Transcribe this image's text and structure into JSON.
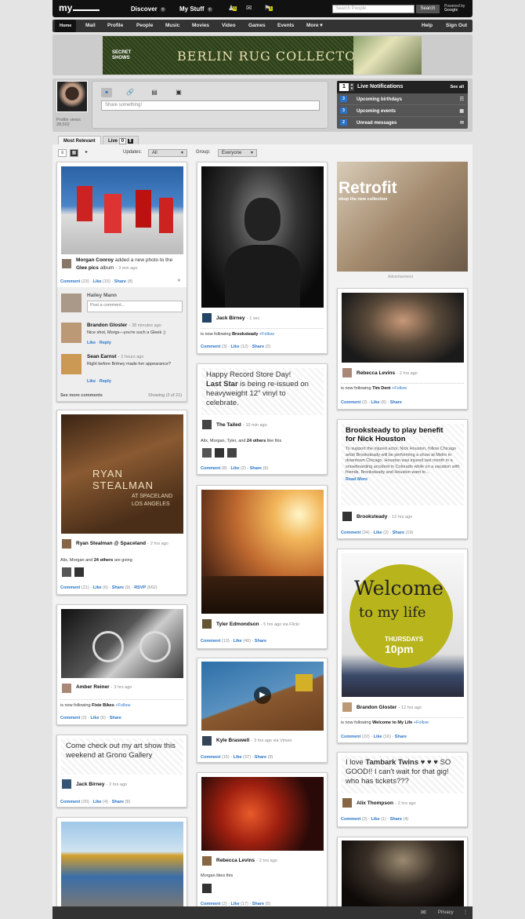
{
  "app": {
    "logo": "my"
  },
  "topnav": {
    "discover": "Discover",
    "mystuff": "My Stuff",
    "badge1": "6",
    "badge2": "1",
    "search_placeholder": "Search People",
    "search_button": "Search",
    "powered": "Powered by",
    "google": "Google"
  },
  "nav": [
    "Home",
    "Mail",
    "Profile",
    "People",
    "Music",
    "Movies",
    "Video",
    "Games",
    "Events",
    "More"
  ],
  "nav_right": [
    "Help",
    "Sign Out"
  ],
  "banner": {
    "brand": "SECRET SHOWS",
    "title": "BERLIN RUG COLLECTORS"
  },
  "profile": {
    "views_label": "Profile views",
    "views": "28,502",
    "share_placeholder": "Share something!"
  },
  "notifications": {
    "count": "1",
    "title": "Live Notifications",
    "see_all": "See all",
    "rows": [
      {
        "n": "3",
        "label": "Upcoming birthdays"
      },
      {
        "n": "3",
        "label": "Upcoming events"
      },
      {
        "n": "2",
        "label": "Unread messages"
      }
    ]
  },
  "tabs": {
    "relevant": "Most Relevant",
    "live": "Live",
    "live_count": "0"
  },
  "filters": {
    "updates_label": "Updates:",
    "updates_value": "All",
    "group_label": "Group:",
    "group_value": "Everyone"
  },
  "col1": {
    "c1": {
      "author": "Morgan Conroy",
      "text": "added a new photo to the",
      "album": "Glee pics",
      "album_sfx": "album",
      "time": "3 min ago",
      "comment": "Comment",
      "comment_n": "(23)",
      "like": "Like",
      "like_n": "(15)",
      "share": "Share",
      "share_n": "(8)",
      "commenter": "Hailey Mann",
      "add_comment": "Post a comment...",
      "c1name": "Brandon Gloster",
      "c1time": "38 minutes ago",
      "c1text": "Nice shot, Morgs—you're such a Gleek ;)",
      "c2name": "Sean Earnst",
      "c2time": "2 hours ago",
      "c2text": "Right before Britney made her appearance?",
      "reply": "Reply",
      "see_more": "See more comments",
      "showing": "Showing (2 of 21)"
    },
    "c2": {
      "img": "RYAN STEALMAN",
      "img_sub": "AT SPACELAND LOS ANGELES",
      "author": "Ryan Stealman @ Spaceland",
      "time": "2 hrs ago",
      "going_a": "Alix, Morgan",
      "going_and": "and",
      "going_b": "24 others",
      "going_c": "are going",
      "comment": "Comment",
      "comment_n": "(21)",
      "like": "Like",
      "like_n": "(6)",
      "share": "Share",
      "share_n": "(9)",
      "rsvp": "RSVP",
      "rsvp_n": "(662)"
    },
    "c3": {
      "author": "Amber Reiner",
      "time": "3 hrs ago",
      "following": "is now following",
      "target": "Fixie Bikes",
      "follow": "+Follow",
      "comment": "Comment",
      "comment_n": "(2)",
      "like": "Like",
      "like_n": "(6)",
      "share": "Share"
    },
    "c4": {
      "quote": "Come check out my art show this weekend at Grono Gallery",
      "author": "Jack Birney",
      "time": "2 hrs ago",
      "comment": "Comment",
      "comment_n": "(20)",
      "like": "Like",
      "like_n": "(4)",
      "share": "Share",
      "share_n": "(8)"
    }
  },
  "col2": {
    "c1": {
      "author": "Jack Birney",
      "time": "1 sec",
      "following": "is now following",
      "target": "Brooksteady",
      "follow": "+Follow",
      "comment": "Comment",
      "comment_n": "(3)",
      "like": "Like",
      "like_n": "(12)",
      "share": "Share",
      "share_n": "(2)"
    },
    "c2": {
      "q1": "Happy Record Store Day!",
      "q2": "Last Star",
      "q3": "is being re-issued on heavyweight 12\" vinyl to celebrate.",
      "author": "The Tailed",
      "time": "10 min ago",
      "likes_a": "Alix, Morgan, Tyler,",
      "likes_and": "and",
      "likes_b": "24 others",
      "likes_c": "like this",
      "comment": "Comment",
      "comment_n": "(8)",
      "like": "Like",
      "like_n": "(2)",
      "share": "Share",
      "share_n": "(6)"
    },
    "c3": {
      "author": "Tyler Edmondson",
      "time": "5 hrs ago via Flickr",
      "comment": "Comment",
      "comment_n": "(13)",
      "like": "Like",
      "like_n": "(40)",
      "share": "Share"
    },
    "c4": {
      "author": "Kyle Braswell",
      "time": "3 hrs ago via Vimeo",
      "comment": "Comment",
      "comment_n": "(15)",
      "like": "Like",
      "like_n": "(37)",
      "share": "Share",
      "share_n": "(9)"
    },
    "c5": {
      "author": "Rebecca Levins",
      "time": "2 hrs ago",
      "likes": "Morgan",
      "likes_c": "likes this",
      "comment": "Comment",
      "comment_n": "(2)",
      "like": "Like",
      "like_n": "(17)",
      "share": "Share",
      "share_n": "(5)"
    }
  },
  "col3": {
    "ad": {
      "title": "Retrofit",
      "sub": "shop the new collection",
      "label": "Advertisement"
    },
    "c1": {
      "author": "Rebecca Levins",
      "time": "2 hrs ago",
      "following": "is now following",
      "target": "Tim Dent",
      "follow": "+Follow",
      "comment": "Comment",
      "comment_n": "(2)",
      "like": "Like",
      "like_n": "(8)",
      "share": "Share"
    },
    "c2": {
      "title": "Brooksteady to play benefit for Nick Houston",
      "body": "To support the injured actor, Nick Houston, follow Chicago artist Brooksteady will be performing a show at Metro in downtown Chicago. Houston was injured last month in a snowboarding accident in Colorado while on a vacation with friends. Brooksteady and Houston want to...",
      "read_more": "Read More",
      "author": "Brooksteady",
      "time": "12 hrs ago",
      "comment": "Comment",
      "comment_n": "(34)",
      "like": "Like",
      "like_n": "(2)",
      "share": "Share",
      "share_n": "(19)"
    },
    "c3": {
      "w1": "Welcome",
      "w2": "to my life",
      "w3": "THURSDAYS",
      "w4": "10pm",
      "author": "Brandon Gloster",
      "time": "12 hrs ago",
      "following": "is now following",
      "target": "Welcome to My Life",
      "follow": "+Follow",
      "comment": "Comment",
      "comment_n": "(22)",
      "like": "Like",
      "like_n": "(16)",
      "share": "Share"
    },
    "c4": {
      "q1": "I love",
      "q2": "Tambark Twins",
      "q3": "♥ ♥ ♥ SO GOOD!! I can't wait for that gig! who has tickets???",
      "author": "Alix Thompson",
      "time": "2 hrs ago",
      "comment": "Comment",
      "comment_n": "(2)",
      "like": "Like",
      "like_n": "(1)",
      "share": "Share",
      "share_n": "(4)"
    }
  },
  "footer": {
    "privacy": "Privacy"
  }
}
